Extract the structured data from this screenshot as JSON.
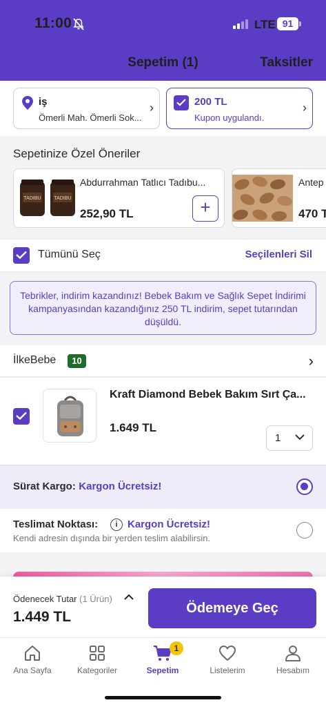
{
  "status_bar": {
    "time": "11:00",
    "network": "LTE",
    "battery": "91"
  },
  "header": {
    "title": "Sepetim (1)",
    "right_link": "Taksitler"
  },
  "address_card": {
    "title": "iş",
    "subtitle": "Ömerli Mah. Ömerli Sok..."
  },
  "coupon_card": {
    "title": "200 TL",
    "subtitle": "Kupon uygulandı."
  },
  "recommendations": {
    "title": "Sepetinize Özel Öneriler",
    "items": [
      {
        "name": "Abdurrahman Tatlıcı Tadıbu...",
        "price": "252,90 TL",
        "add_label": "+"
      },
      {
        "name": "Antep",
        "price": "470 T"
      }
    ]
  },
  "select_bar": {
    "select_all": "Tümünü Seç",
    "delete_selected": "Seçilenleri Sil"
  },
  "discount_info": "Tebrikler, indirim kazandınız! Bebek Bakım ve Sağlık Sepet İndirimi kampanyasından kazandığınız 250 TL indirim, sepet tutarından düşüldü.",
  "seller": {
    "name": "İlkeBebe",
    "rating": "10"
  },
  "cart_item": {
    "name": "Kraft Diamond Bebek Bakım Sırt Ça...",
    "price": "1.649 TL",
    "quantity": "1"
  },
  "shipping": {
    "option1": {
      "label": "Sürat Kargo:",
      "value": "Kargon Ücretsiz!"
    },
    "option2": {
      "label": "Teslimat Noktası:",
      "value": "Kargon Ücretsiz!",
      "info_icon": "i",
      "subtitle": "Kendi adresin dışında bir yerden teslim alabilirsin."
    }
  },
  "checkout": {
    "label": "Ödenecek Tutar",
    "count": "(1 Ürün)",
    "total": "1.449 TL",
    "button": "Ödemeye Geç"
  },
  "tabs": [
    {
      "label": "Ana Sayfa",
      "icon": "home-icon"
    },
    {
      "label": "Kategoriler",
      "icon": "grid-icon"
    },
    {
      "label": "Sepetim",
      "icon": "cart-icon",
      "badge": "1"
    },
    {
      "label": "Listelerim",
      "icon": "heart-icon"
    },
    {
      "label": "Hesabım",
      "icon": "user-icon"
    }
  ],
  "colors": {
    "brand": "#5b3cc4",
    "seller_badge": "#1f6b2a",
    "cart_badge": "#f5c400"
  }
}
